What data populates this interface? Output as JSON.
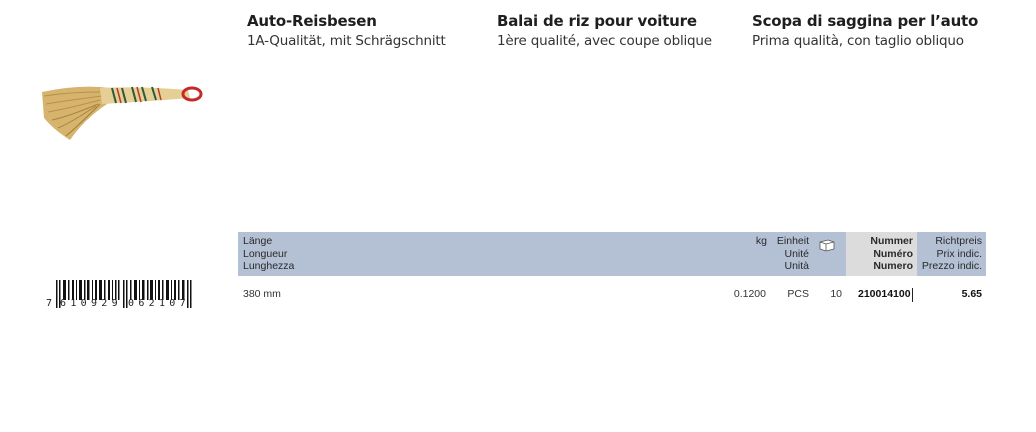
{
  "product": {
    "de": {
      "title": "Auto-Reisbesen",
      "subtitle": "1A-Qualität, mit Schrägschnitt"
    },
    "fr": {
      "title": "Balai de riz pour voiture",
      "subtitle": "1ère qualité, avec coupe oblique"
    },
    "it": {
      "title": "Scopa di saggina per l’auto",
      "subtitle": "Prima qualità, con taglio obliquo"
    },
    "image": "rice-broom-image"
  },
  "table": {
    "header": {
      "length": [
        "Länge",
        "Longueur",
        "Lunghezza"
      ],
      "kg": "kg",
      "unit": [
        "Einheit",
        "Unité",
        "Unità"
      ],
      "pack_icon": "package-icon",
      "number": [
        "Nummer",
        "Numéro",
        "Numero"
      ],
      "price": [
        "Richtpreis",
        "Prix indic.",
        "Prezzo indic."
      ]
    },
    "rows": [
      {
        "length": "380 mm",
        "kg": "0.1200",
        "unit": "PCS",
        "pack": "10",
        "number": "210014100",
        "price": "5.65"
      }
    ]
  },
  "barcode": {
    "first_digit": "7",
    "group1": "610929",
    "group2": "062107"
  }
}
